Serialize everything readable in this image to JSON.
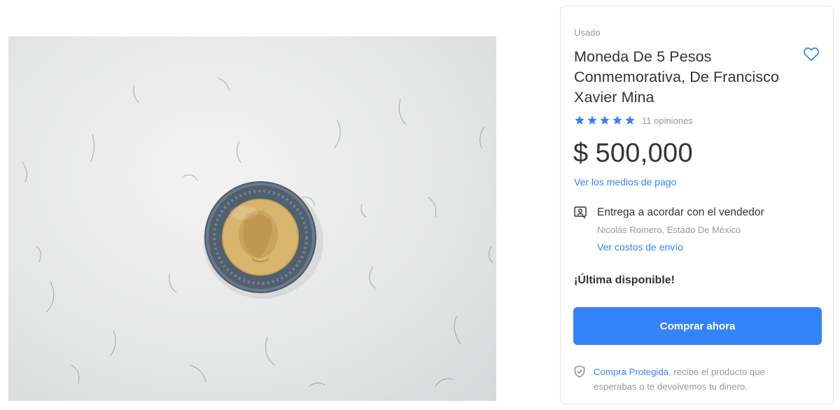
{
  "product": {
    "image_alt": "Moneda de 5 pesos sobre superficie blanca",
    "condition": "Usado",
    "title": "Moneda De 5 Pesos Conmemorativa, De Francisco Xavier Mina",
    "favorite_icon": "heart-outline-icon",
    "rating": {
      "stars": 5,
      "max_stars": 5,
      "count_label": "11 opiniones"
    },
    "price": {
      "currency_symbol": "$",
      "amount": "500,000"
    },
    "payment_link": "Ver los medios de pago",
    "delivery": {
      "icon": "person-card-icon",
      "title": "Entrega a acordar con el vendedor",
      "location": "Nicolás Romero, Estado De México",
      "shipping_link": "Ver costos de envío"
    },
    "stock_status": "¡Última disponible!",
    "buy_button": "Comprar ahora",
    "protection": {
      "icon": "shield-check-icon",
      "link": "Compra Protegida",
      "text": ", recibe el producto que esperabas o te devolvemos tu dinero."
    }
  },
  "colors": {
    "accent": "#3483fa",
    "text": "#333333",
    "muted": "#999999",
    "border": "#e7e7e7"
  }
}
